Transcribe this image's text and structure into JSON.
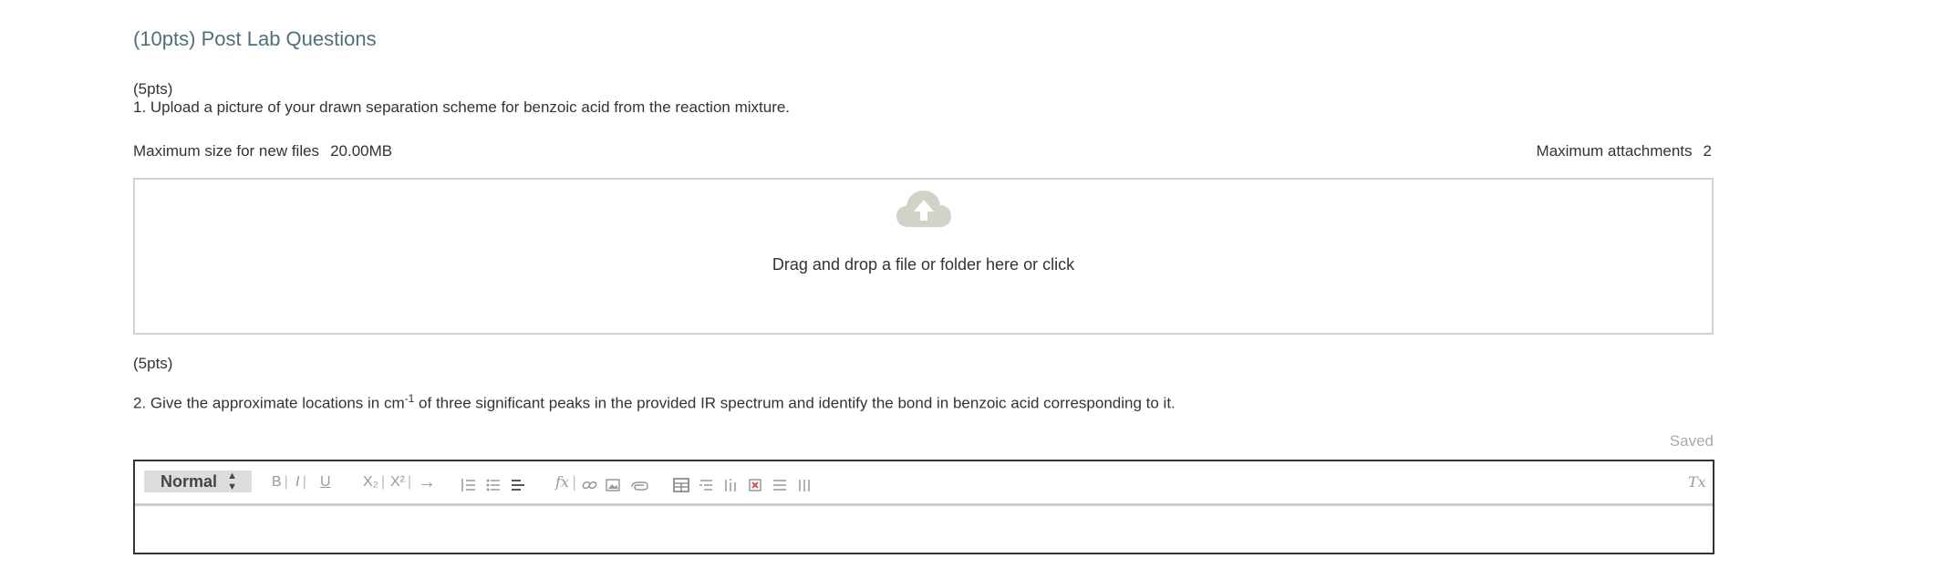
{
  "section_title": "(10pts) Post Lab Questions",
  "q1": {
    "points": "(5pts)",
    "text": "1. Upload a picture of your drawn separation scheme for benzoic acid from the reaction mixture.",
    "max_size_label": "Maximum size for new files",
    "max_size_value": "20.00MB",
    "max_attach_label": "Maximum attachments",
    "max_attach_value": "2",
    "dropzone_text": "Drag and drop a file or folder here or click"
  },
  "q2": {
    "points": "(5pts)",
    "text_before": "2. Give the approximate locations in cm",
    "text_sup": "-1",
    "text_after": " of three significant peaks in the provided IR spectrum and identify the bond in benzoic acid corresponding to it.",
    "status": "Saved"
  },
  "editor": {
    "format_value": "Normal",
    "tools": {
      "bold": "B",
      "italic": "I",
      "underline": "U",
      "subscript": "X₂",
      "superscript": "X²",
      "arrow": "→",
      "formula": "fx",
      "clear_format": "Tx"
    }
  },
  "colors": {
    "title": "#4f6f7a",
    "dropzone_border": "#d1d3c8",
    "cloud": "#d1d3c8",
    "saved": "#aaaaaa"
  }
}
